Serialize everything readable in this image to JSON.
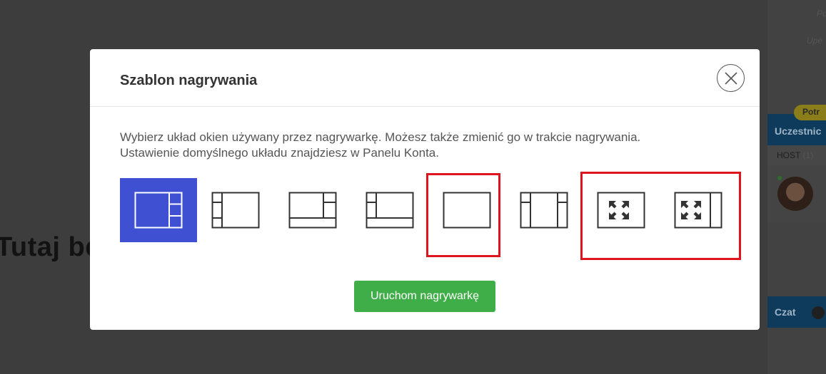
{
  "background": {
    "heading": "Tutaj bę",
    "sidebar_text_1": "Pc",
    "sidebar_text_2": "Upe",
    "badge": "Potr",
    "participants_label": "Uczestnic",
    "host_label": "HOST",
    "host_count": "(1)",
    "chat_label": "Czat"
  },
  "modal": {
    "title": "Szablon nagrywania",
    "description_line_1": "Wybierz układ okien używany przez nagrywarkę. Możesz także zmienić go w trakcie nagrywania.",
    "description_line_2": "Ustawienie domyślnego układu znajdziesz w Panelu Konta.",
    "start_button": "Uruchom nagrywarkę",
    "selected_layout_index": 0,
    "layouts": [
      {
        "icon": "layout-main-right-split-icon",
        "selected": true
      },
      {
        "icon": "layout-left-strip-icon",
        "selected": false
      },
      {
        "icon": "layout-right-strip-bottom-bar-icon",
        "selected": false
      },
      {
        "icon": "layout-left-strip-bottom-bar-icon",
        "selected": false
      },
      {
        "icon": "layout-single-icon",
        "selected": false
      },
      {
        "icon": "layout-both-strips-icon",
        "selected": false
      },
      {
        "icon": "layout-fullscreen-icon",
        "selected": false
      },
      {
        "icon": "layout-fullscreen-right-strip-icon",
        "selected": false
      }
    ]
  },
  "colors": {
    "selected": "#3f51d2",
    "start_button": "#3fae49",
    "highlight": "#e0141e",
    "icon_stroke": "#333333"
  }
}
